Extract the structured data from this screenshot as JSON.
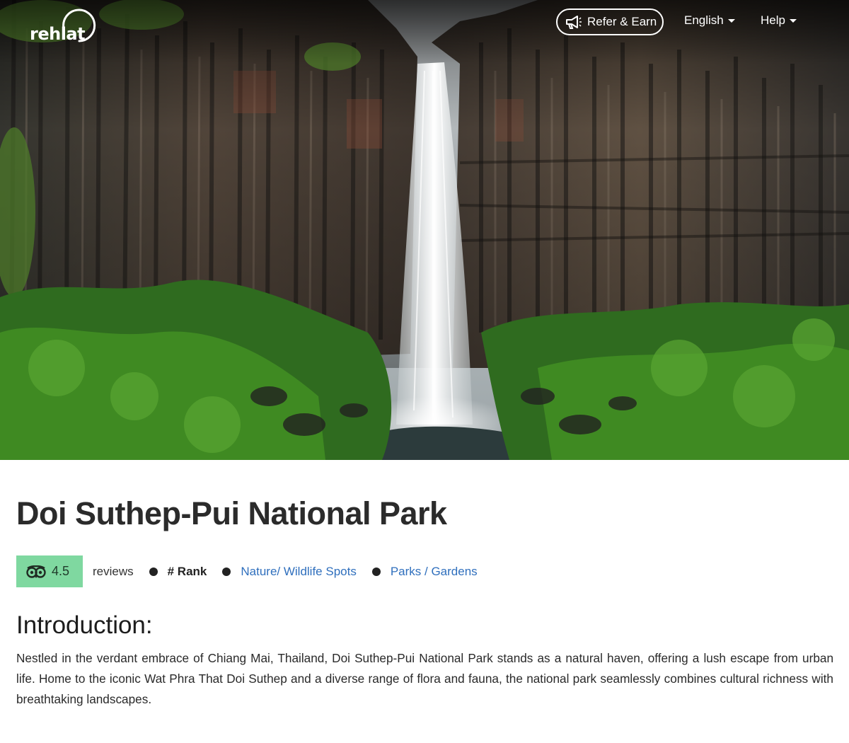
{
  "brand": {
    "logo_text": "rehlat"
  },
  "header": {
    "refer_label": "Refer & Earn",
    "language_label": "English",
    "help_label": "Help"
  },
  "hero": {
    "image_subject": "waterfall-basalt-cliff"
  },
  "place": {
    "title": "Doi Suthep-Pui National Park",
    "rating": "4.5",
    "reviews_label": "reviews",
    "rank_label": "# Rank",
    "categories": [
      "Nature/ Wildlife Spots",
      "Parks / Gardens"
    ]
  },
  "introduction": {
    "heading": "Introduction:",
    "body": "Nestled in the verdant embrace of Chiang Mai, Thailand, Doi Suthep-Pui National Park stands as a natural haven, offering a lush escape from urban life. Home to the iconic Wat Phra That Doi Suthep and a diverse range of flora and fauna, the national park seamlessly combines cultural richness with breathtaking landscapes."
  },
  "colors": {
    "rating_badge": "#7fd8a0",
    "link": "#2f6fbd",
    "title": "#2b2b2b"
  },
  "icons": {
    "refer": "megaphone-icon",
    "rating": "tripadvisor-owl-icon",
    "dropdown": "caret-down-icon"
  }
}
